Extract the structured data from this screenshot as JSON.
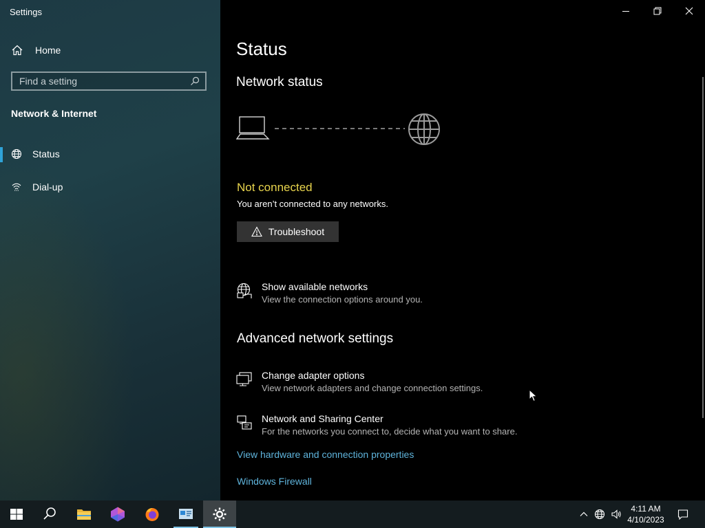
{
  "window": {
    "title": "Settings",
    "controls": [
      "minimize",
      "restore",
      "close"
    ]
  },
  "sidebar": {
    "home_label": "Home",
    "search_placeholder": "Find a setting",
    "section_title": "Network & Internet",
    "items": [
      {
        "label": "Status",
        "icon": "globe-network-icon",
        "selected": true
      },
      {
        "label": "Dial-up",
        "icon": "dialup-icon",
        "selected": false
      }
    ]
  },
  "main": {
    "title": "Status",
    "network_status_title": "Network status",
    "connection_state": "Not connected",
    "connection_desc": "You aren’t connected to any networks.",
    "troubleshoot_label": "Troubleshoot",
    "show_networks": {
      "title": "Show available networks",
      "desc": "View the connection options around you."
    },
    "advanced_title": "Advanced network settings",
    "advanced_items": [
      {
        "title": "Change adapter options",
        "desc": "View network adapters and change connection settings.",
        "icon": "adapter-icon"
      },
      {
        "title": "Network and Sharing Center",
        "desc": "For the networks you connect to, decide what you want to share.",
        "icon": "sharing-center-icon"
      }
    ],
    "links": [
      "View hardware and connection properties",
      "Windows Firewall"
    ]
  },
  "colors": {
    "accent": "#2fa3d8",
    "warning": "#e8d44d",
    "link": "#5fb4dc"
  },
  "taskbar": {
    "apps": [
      "start-icon",
      "search-icon",
      "file-explorer-icon",
      "app-icon",
      "firefox-icon",
      "control-panel-icon",
      "settings-gear-icon"
    ],
    "clock_time": "4:11 AM",
    "clock_date": "4/10/2023"
  }
}
